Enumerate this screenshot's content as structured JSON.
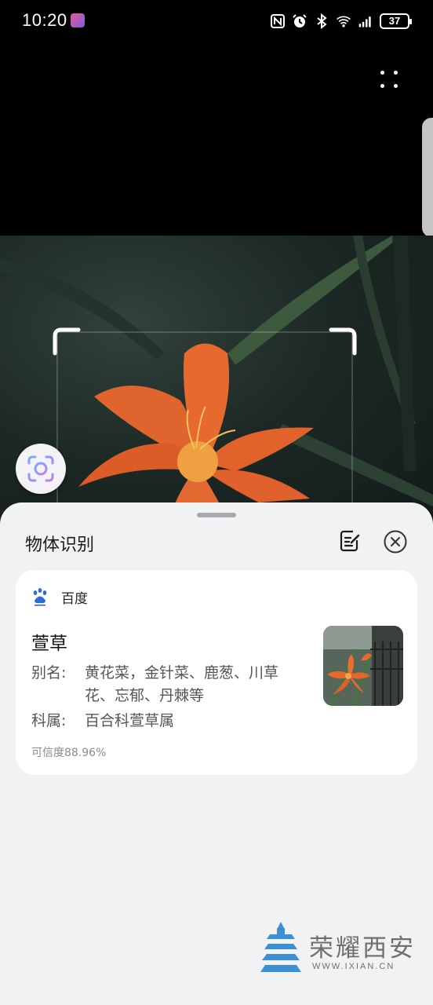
{
  "status_bar": {
    "time": "10:20",
    "battery": "37"
  },
  "sheet": {
    "title": "物体识别"
  },
  "result": {
    "source": "百度",
    "name": "萱草",
    "alias_label": "别名:",
    "alias_value": "黄花菜，金针菜、鹿葱、川草花、忘郁、丹棘等",
    "family_label": "科属:",
    "family_value": "百合科萱草属",
    "confidence": "可信度88.96%"
  },
  "watermark": {
    "title": "荣耀西安",
    "url": "WWW.IXIAN.CN"
  },
  "colors": {
    "accent_blue": "#2d6cd7",
    "sheet_bg": "#f1f2f4",
    "card_bg": "#ffffff",
    "watermark_blue": "#3b8fd2"
  },
  "icons": {
    "more": "more-vertical-icon",
    "scan": "lens-scan-icon",
    "edit": "edit-note-icon",
    "close": "close-circle-icon",
    "source": "baidu-paw-icon"
  }
}
